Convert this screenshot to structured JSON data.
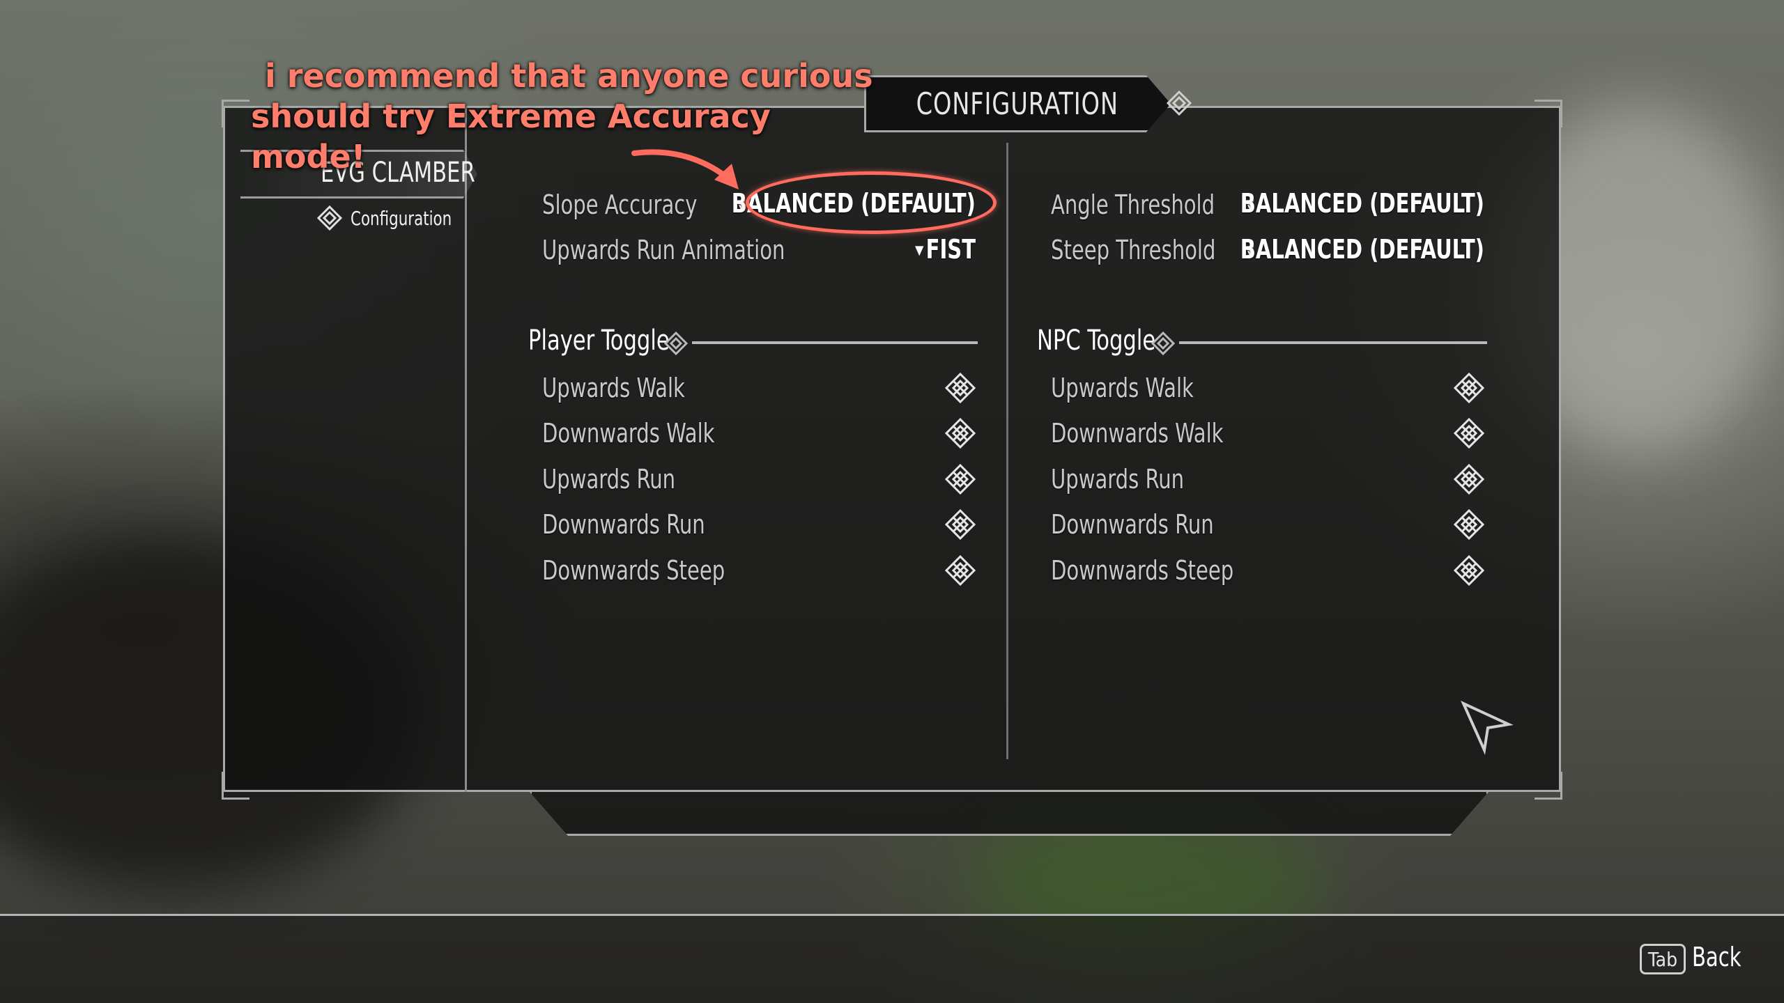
{
  "annotation": {
    "line1": "i recommend that anyone curious",
    "line2": "should try Extreme Accuracy mode!",
    "color": "#ff7d6b"
  },
  "window": {
    "title": "CONFIGURATION"
  },
  "sidebar": {
    "mod_name": "EVG CLAMBER",
    "pages": [
      {
        "label": "Configuration",
        "icon": "knot-icon"
      }
    ]
  },
  "left_options": [
    {
      "label": "Slope Accuracy",
      "value": "BALANCED (DEFAULT)"
    },
    {
      "label": "Upwards Run Animation",
      "value": "FIST"
    }
  ],
  "right_options": [
    {
      "label": "Angle Threshold",
      "value": "BALANCED (DEFAULT)"
    },
    {
      "label": "Steep Threshold",
      "value": "BALANCED (DEFAULT)"
    }
  ],
  "player_toggle": {
    "header": "Player Toggle",
    "items": [
      "Upwards Walk",
      "Downwards Walk",
      "Upwards Run",
      "Downwards Run",
      "Downwards Steep"
    ]
  },
  "npc_toggle": {
    "header": "NPC Toggle",
    "items": [
      "Upwards Walk",
      "Downwards Walk",
      "Upwards Run",
      "Downwards Run",
      "Downwards Steep"
    ]
  },
  "footer": {
    "key": "Tab",
    "action": "Back"
  }
}
